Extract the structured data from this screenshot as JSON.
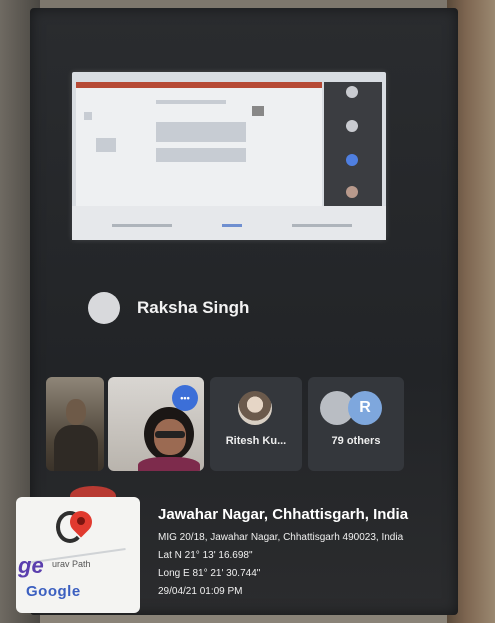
{
  "presenter": {
    "avatar_initial": "",
    "name": "Raksha Singh"
  },
  "participants": {
    "more_button": "•••",
    "tile3_name": "Ritesh Ku...",
    "others_avatar": "R",
    "others_label": "79 others"
  },
  "geotag": {
    "brand_fragment": "ge",
    "path_fragment": "urav Path",
    "google": "Google",
    "title": "Jawahar Nagar, Chhattisgarh, India",
    "address": "MIG 20/18, Jawahar Nagar, Chhattisgarh 490023, India",
    "lat": "Lat N 21° 13' 16.698\"",
    "long": "Long E 81° 21' 30.744\"",
    "datetime": "29/04/21 01:09 PM"
  },
  "colors": {
    "accent_blue": "#3c6fd8",
    "pin_red": "#e13a2f",
    "screen_bg": "#222427"
  },
  "icons": [
    "raise-hand-icon",
    "mic-icon",
    "navigation-icon",
    "more-icon",
    "map-pin-icon"
  ]
}
